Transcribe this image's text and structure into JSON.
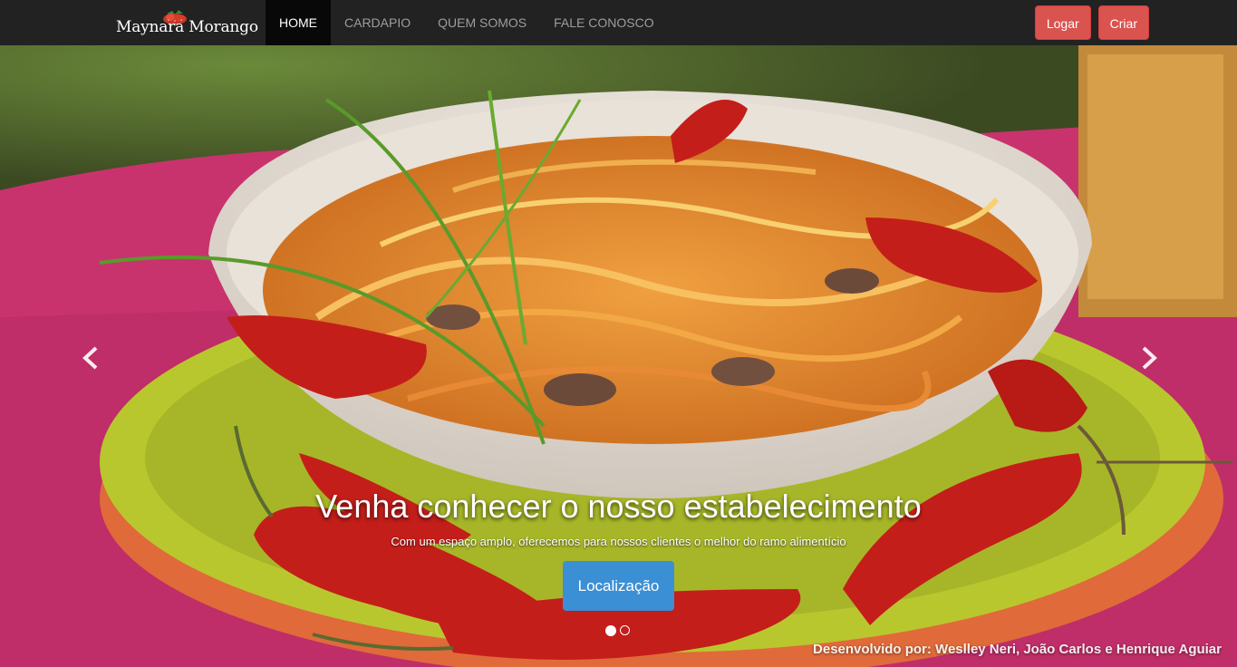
{
  "brand": {
    "name": "Maynara Morango",
    "logo_icon": "strawberry-icon"
  },
  "nav": {
    "items": [
      {
        "label": "HOME",
        "active": true
      },
      {
        "label": "CARDAPIO",
        "active": false
      },
      {
        "label": "QUEM SOMOS",
        "active": false
      },
      {
        "label": "FALE CONOSCO",
        "active": false
      }
    ]
  },
  "auth": {
    "login_label": "Logar",
    "signup_label": "Criar"
  },
  "carousel": {
    "title": "Venha conhecer o nosso estabelecimento",
    "subtitle": "Com um espaço amplo, oferecemos para nossos clientes o melhor do ramo alimentício",
    "button_label": "Localização",
    "prev_icon": "chevron-left-icon",
    "next_icon": "chevron-right-icon",
    "slide_count": 2,
    "active_slide": 1
  },
  "footer": {
    "credit": "Desenvolvido por: Weslley Neri, João Carlos e Henrique Aguiar"
  },
  "colors": {
    "navbar": "#222222",
    "nav_active": "#080808",
    "button_red": "#d9534f",
    "button_blue": "#3b8fd4"
  }
}
